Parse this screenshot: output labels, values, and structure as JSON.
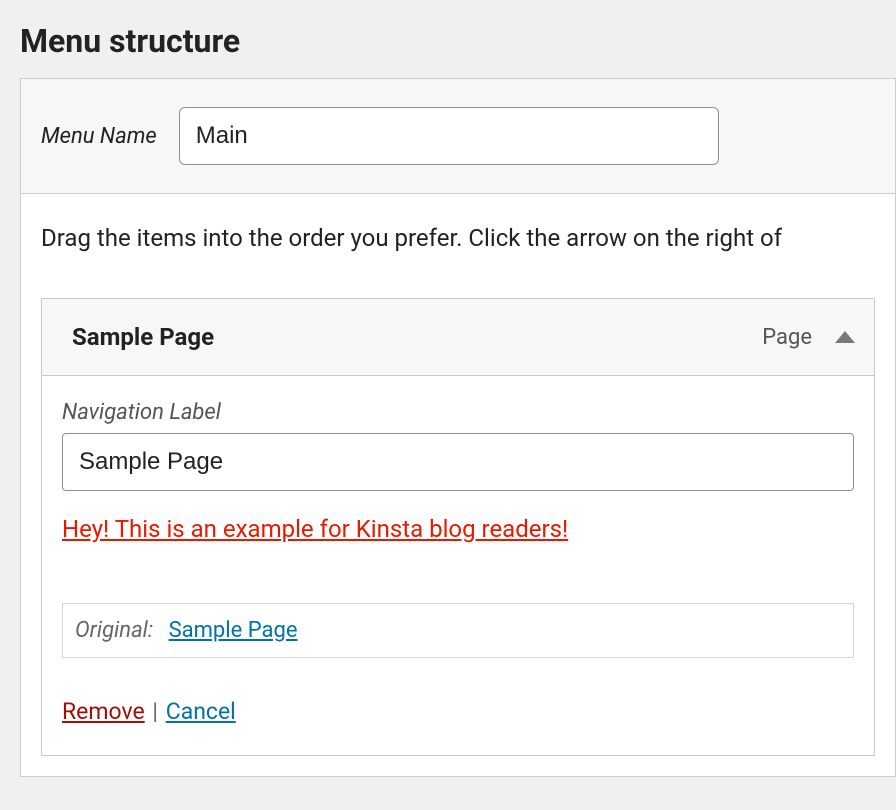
{
  "page": {
    "title": "Menu structure"
  },
  "menu": {
    "name_label": "Menu Name",
    "name_value": "Main"
  },
  "instructions": "Drag the items into the order you prefer. Click the arrow on the right of",
  "item": {
    "title": "Sample Page",
    "type_label": "Page",
    "nav_label_label": "Navigation Label",
    "nav_label_value": "Sample Page",
    "custom_note": "Hey! This is an example for Kinsta blog readers!",
    "original_label": "Original:",
    "original_link": "Sample Page",
    "remove_label": "Remove",
    "separator": " | ",
    "cancel_label": "Cancel"
  }
}
